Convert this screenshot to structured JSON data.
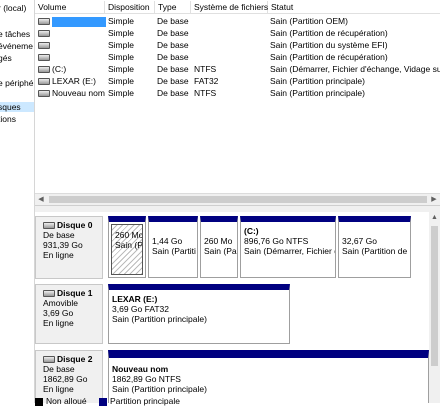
{
  "nav": {
    "items": [
      "r (local)",
      "e tâches",
      "événeme",
      "gés",
      "e périphé",
      "sques",
      "tions"
    ],
    "selected_index": 5
  },
  "volume_list": {
    "columns": [
      "Volume",
      "Disposition",
      "Type",
      "Système de fichiers",
      "Statut"
    ],
    "rows": [
      {
        "volume": "",
        "layout": "Simple",
        "type": "De base",
        "fs": "",
        "status": "Sain (Partition OEM)",
        "selected": true
      },
      {
        "volume": "",
        "layout": "Simple",
        "type": "De base",
        "fs": "",
        "status": "Sain (Partition de récupération)"
      },
      {
        "volume": "",
        "layout": "Simple",
        "type": "De base",
        "fs": "",
        "status": "Sain (Partition du système EFI)"
      },
      {
        "volume": "",
        "layout": "Simple",
        "type": "De base",
        "fs": "",
        "status": "Sain (Partition de récupération)"
      },
      {
        "volume": "(C:)",
        "layout": "Simple",
        "type": "De base",
        "fs": "NTFS",
        "status": "Sain (Démarrer, Fichier d'échange, Vidage sur in"
      },
      {
        "volume": "LEXAR (E:)",
        "layout": "Simple",
        "type": "De base",
        "fs": "FAT32",
        "status": "Sain (Partition principale)"
      },
      {
        "volume": "Nouveau nom",
        "layout": "Simple",
        "type": "De base",
        "fs": "NTFS",
        "status": "Sain (Partition principale)"
      }
    ]
  },
  "disks": [
    {
      "name": "Disque 0",
      "type": "De base",
      "size": "931,39 Go",
      "state": "En ligne",
      "partitions": [
        {
          "size": "260 Mo",
          "status": "Sain (Pa",
          "hatched": true
        },
        {
          "size": "1,44 Go",
          "status": "Sain (Partiti"
        },
        {
          "size": "260 Mo",
          "status": "Sain (Pa"
        },
        {
          "name": "(C:)",
          "size": "896,76 Go NTFS",
          "status": "Sain (Démarrer, Fichier d"
        },
        {
          "size": "32,67 Go",
          "status": "Sain (Partition de r"
        }
      ]
    },
    {
      "name": "Disque 1",
      "type": "Amovible",
      "size": "3,69 Go",
      "state": "En ligne",
      "partitions": [
        {
          "name": "LEXAR  (E:)",
          "size": "3,69 Go FAT32",
          "status": "Sain (Partition principale)"
        }
      ]
    },
    {
      "name": "Disque 2",
      "type": "De base",
      "size": "1862,89 Go",
      "state": "En ligne",
      "partitions": [
        {
          "name": "Nouveau nom",
          "size": "1862,89 Go NTFS",
          "status": "Sain (Partition principale)"
        }
      ]
    }
  ],
  "legend": {
    "unallocated": "Non alloué",
    "primary": "Partition principale",
    "unallocated_color": "#000000",
    "primary_color": "#000080"
  },
  "colors": {
    "partition_bar": "#000080",
    "selection": "#3399ff",
    "nav_selected": "#cce8ff"
  }
}
